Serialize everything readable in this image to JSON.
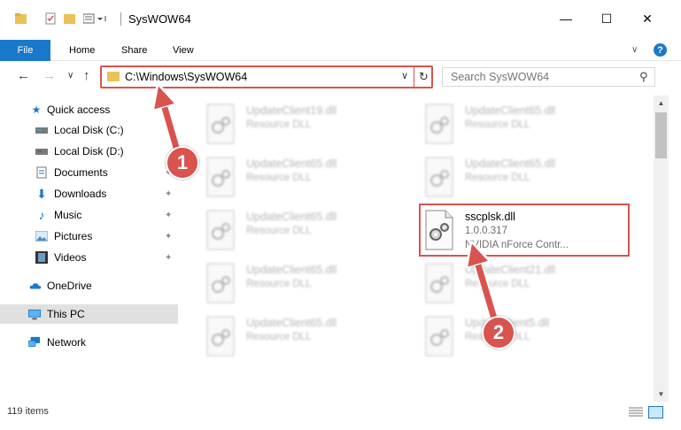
{
  "window": {
    "title": "SysWOW64",
    "minimize_glyph": "—",
    "maximize_glyph": "☐",
    "close_glyph": "✕"
  },
  "ribbon": {
    "tabs": [
      "File",
      "Home",
      "Share",
      "View"
    ],
    "collapse_glyph": "∨",
    "help_glyph": "?"
  },
  "nav": {
    "back_glyph": "←",
    "forward_glyph": "→",
    "recent_glyph": "∨",
    "up_glyph": "↑",
    "address": "C:\\Windows\\SysWOW64",
    "address_dropdown_glyph": "∨",
    "refresh_glyph": "↻",
    "search_placeholder": "Search SysWOW64",
    "search_glyph": "⚲"
  },
  "sidebar": {
    "items": [
      {
        "label": "Quick access",
        "icon": "star-icon",
        "pinned": false
      },
      {
        "label": "Local Disk (C:)",
        "icon": "drive-icon",
        "pinned": false
      },
      {
        "label": "Local Disk (D:)",
        "icon": "drive-icon",
        "pinned": false
      },
      {
        "label": "Documents",
        "icon": "documents-icon",
        "pinned": true
      },
      {
        "label": "Downloads",
        "icon": "downloads-icon",
        "pinned": true
      },
      {
        "label": "Music",
        "icon": "music-icon",
        "pinned": true
      },
      {
        "label": "Pictures",
        "icon": "pictures-icon",
        "pinned": true
      },
      {
        "label": "Videos",
        "icon": "videos-icon",
        "pinned": true
      },
      {
        "label": "OneDrive",
        "icon": "cloud-icon",
        "pinned": false
      },
      {
        "label": "This PC",
        "icon": "computer-icon",
        "pinned": false,
        "selected": true
      },
      {
        "label": "Network",
        "icon": "network-icon",
        "pinned": false
      }
    ],
    "pin_glyph": "📌"
  },
  "files": [
    {
      "name": "UpdateClient19.dll",
      "type": "Resource DLL"
    },
    {
      "name": "UpdateClient65.dll",
      "type": "Resource DLL"
    },
    {
      "name": "UpdateClient65.dll",
      "type": "Resource DLL"
    },
    {
      "name": "UpdateClient65.dll",
      "type": "Resource DLL"
    },
    {
      "name": "UpdateClient65.dll",
      "type": "Resource DLL"
    },
    {
      "name": "sscplsk.dll",
      "version": "1.0.0.317",
      "description": "NVIDIA nForce Contr...",
      "highlighted": true
    },
    {
      "name": "UpdateClient65.dll",
      "type": "Resource DLL"
    },
    {
      "name": "UpdateClient21.dll",
      "type": "Resource DLL"
    },
    {
      "name": "UpdateClient65.dll",
      "type": "Resource DLL"
    },
    {
      "name": "UpdateClient5.dll",
      "type": "Resource DLL"
    }
  ],
  "status": {
    "item_count": "119 items"
  },
  "annotations": {
    "step1": "1",
    "step2": "2",
    "color": "#d9534f"
  },
  "colors": {
    "accent": "#1979ca",
    "highlight_red": "#d9534f",
    "folder": "#e8c35a"
  }
}
